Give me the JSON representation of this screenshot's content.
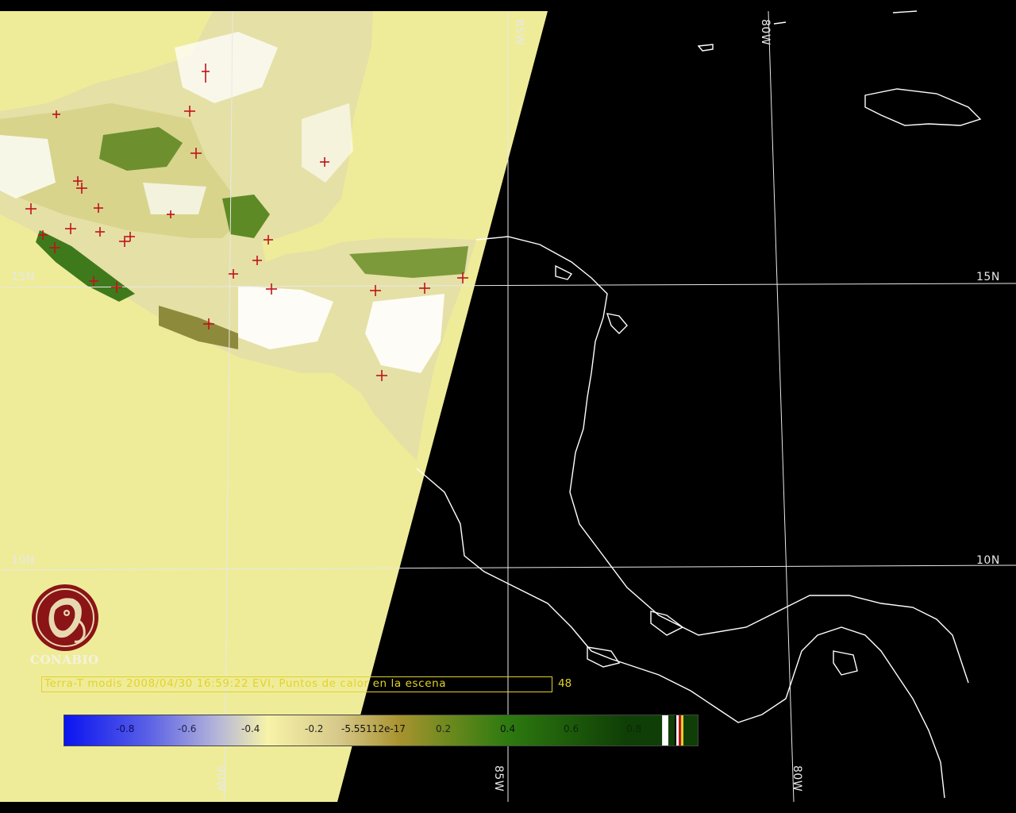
{
  "map": {
    "title": "Terra-T modis 2008/04/30 16:59:22 EVI, Puntos de calor en la escena",
    "hotspot_count": "48",
    "grid_labels": {
      "lat_15_left": "15N",
      "lat_15_right": "15N",
      "lat_10_left": "10N",
      "lat_10_right": "10N",
      "lon_85_top": "85W",
      "lon_80_top": "80W",
      "lon_90_bottom": "90W",
      "lon_85_bottom": "85W",
      "lon_80_bottom": "80W"
    },
    "colors": {
      "swath_background": "#EFEC99",
      "night_background": "#000000",
      "coast": "#FFFFFF",
      "hotspot": "#C0121A",
      "caption": "#E3D22C"
    }
  },
  "logo": {
    "name": "CONABIO",
    "icon": "conabio-macaw-logo"
  },
  "colorbar": {
    "ticks": [
      "-0.8",
      "-0.6",
      "-0.4",
      "-0.2",
      "-5.55112e-17",
      "0.2",
      "0.4",
      "0.6",
      "0.8"
    ],
    "colors": [
      "#0A14F0",
      "#8A8FE0",
      "#F7F3A8",
      "#D2C07A",
      "#8A7A20",
      "#2E7A10",
      "#103F06"
    ]
  }
}
